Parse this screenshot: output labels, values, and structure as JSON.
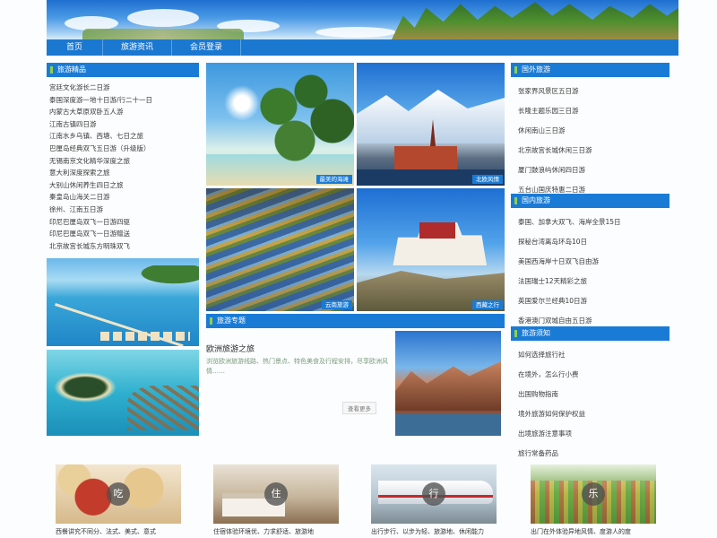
{
  "nav": {
    "items": [
      "首页",
      "旅游资讯",
      "会员登录"
    ]
  },
  "left": {
    "title": "旅游精品",
    "items": [
      "宫廷文化游长二日游",
      "泰国深度游一地十日游/行二十一日",
      "内蒙古大草原双卧五人游",
      "江南古镇四日游",
      "江南水乡乌镇、西塘、七日之旅",
      "巴厘岛经典双飞五日游（升级版）",
      "无锡南京文化精华深度之旅",
      "意大利深度探索之旅",
      "大别山休闲养生四日之旅",
      "秦皇岛山海关二日游",
      "徐州、江南五日游",
      "印尼巴厘岛双飞一日游四驱",
      "印尼巴厘岛双飞一日游赠送",
      "北京故宫长城东方明珠双飞"
    ]
  },
  "tiles": {
    "beach": "最美的海滩",
    "north": "北欧风情",
    "terrace": "云南旅游",
    "tibet": "西藏之行"
  },
  "feature": {
    "bar": "旅游专题",
    "title": "欧洲旅游之旅",
    "desc": "浏览欧洲旅游线路、热门景点、特色美食及行程安排，尽享欧洲风情……",
    "more": "查看更多"
  },
  "right": {
    "sections": [
      {
        "title": "国外旅游",
        "items": [
          "张家界风景区五日游",
          "长隆主题乐园三日游",
          "休闲南山三日游",
          "北京故宫长城休闲三日游",
          "厦门鼓浪屿休闲四日游",
          "五台山国庆特惠二日游"
        ]
      },
      {
        "title": "国内旅游",
        "items": [
          "泰国、加拿大双飞、海岸全景15日",
          "探秘台湾离岛环岛10日",
          "美国西海岸十日双飞自由游",
          "法国瑞士12天精彩之旅",
          "英国爱尔兰经典10日游",
          "香港澳门双城自由五日游"
        ]
      },
      {
        "title": "旅游须知",
        "items": [
          "如何选择旅行社",
          "在境外，怎么行小费",
          "出国购物指南",
          "境外旅游如何保护权益",
          "出境旅游注意事项",
          "旅行常备药品"
        ]
      }
    ]
  },
  "bottom": [
    {
      "char": "吃",
      "caption": "西餐讲究不同分、法式、美式、意式"
    },
    {
      "char": "住",
      "caption": "住宿体验环境优、力求舒适、旅游地"
    },
    {
      "char": "行",
      "caption": "出行步行、以步为轻、旅游地、休闲能力"
    },
    {
      "char": "乐",
      "caption": "出门在外体验异地风情、度游人的度"
    }
  ],
  "colors": {
    "accent": "#1a7bd6",
    "nav": "#1b78d0",
    "marker": "#8fd14a"
  }
}
